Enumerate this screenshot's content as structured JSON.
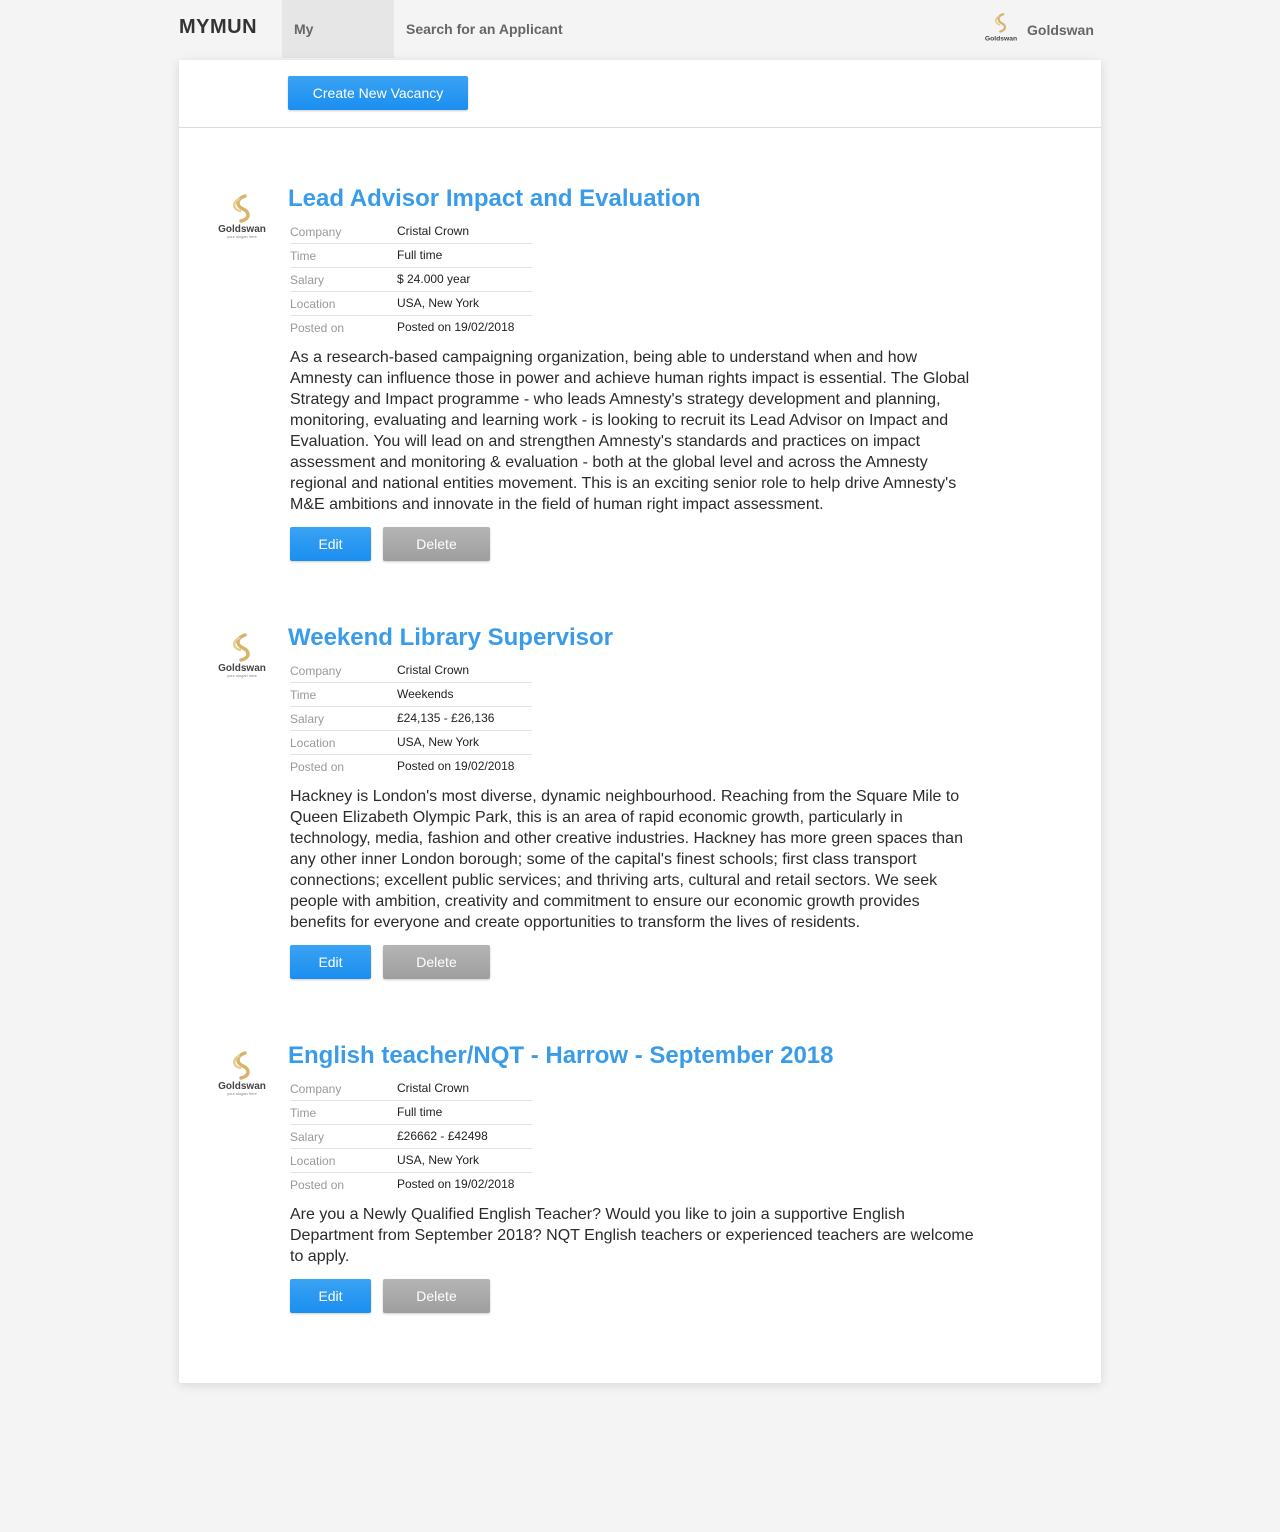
{
  "nav": {
    "brand": "MYMUN",
    "items": [
      {
        "label": "My Vacancies",
        "active": true
      },
      {
        "label": "Search for an Applicant",
        "active": false
      }
    ],
    "user": {
      "name": "Goldswan",
      "logo_text": "Goldswan"
    }
  },
  "actions": {
    "create_label": "Create New Vacancy"
  },
  "logo": {
    "name": "Goldswan",
    "tagline": "your slogan here"
  },
  "detail_labels": {
    "company": "Company",
    "time": "Time",
    "salary": "Salary",
    "location": "Location",
    "posted": "Posted on"
  },
  "buttons": {
    "edit": "Edit",
    "delete": "Delete"
  },
  "colors": {
    "accent": "#3a9ce8",
    "button_blue": "#1b8ef0",
    "button_gray": "#a8a8a8"
  },
  "vacancies": [
    {
      "title": "Lead Advisor Impact and Evaluation",
      "company": "Cristal Crown",
      "time": "Full time",
      "salary": "$ 24.000 year",
      "location": "USA, New York",
      "posted": "Posted on 19/02/2018",
      "description": "As a research-based campaigning organization, being able to understand when and how Amnesty can influence those in power and achieve human rights impact is essential. The Global Strategy and Impact programme - who leads Amnesty's strategy development and planning, monitoring, evaluating and learning work - is looking to recruit its Lead Advisor on Impact and Evaluation. You will lead on and strengthen Amnesty's standards and practices on impact assessment and monitoring & evaluation - both at the global level and across the Amnesty regional and national entities movement. This is an exciting senior role to help drive Amnesty's M&E ambitions and innovate in the field of human right impact assessment."
    },
    {
      "title": "Weekend Library Supervisor",
      "company": "Cristal Crown",
      "time": "Weekends",
      "salary": "£24,135 - £26,136",
      "location": "USA, New York",
      "posted": "Posted on 19/02/2018",
      "description": "Hackney is London's most diverse, dynamic neighbourhood. Reaching from the Square Mile to Queen Elizabeth Olympic Park, this is an area of rapid economic growth, particularly in technology, media, fashion and other creative industries. Hackney has more green spaces than any other inner London borough; some of the capital's finest schools; first class transport connections; excellent public services; and thriving arts, cultural and retail sectors. We seek people with ambition, creativity and commitment to ensure our economic growth provides benefits for everyone and create opportunities to transform the lives of residents."
    },
    {
      "title": "English teacher/NQT - Harrow - September 2018",
      "company": "Cristal Crown",
      "time": "Full time",
      "salary": "£26662 - £42498",
      "location": "USA, New York",
      "posted": "Posted on 19/02/2018",
      "description": "Are you a Newly Qualified English Teacher? Would you like to join a supportive English Department from September 2018? NQT English teachers or experienced teachers are welcome to apply."
    }
  ]
}
